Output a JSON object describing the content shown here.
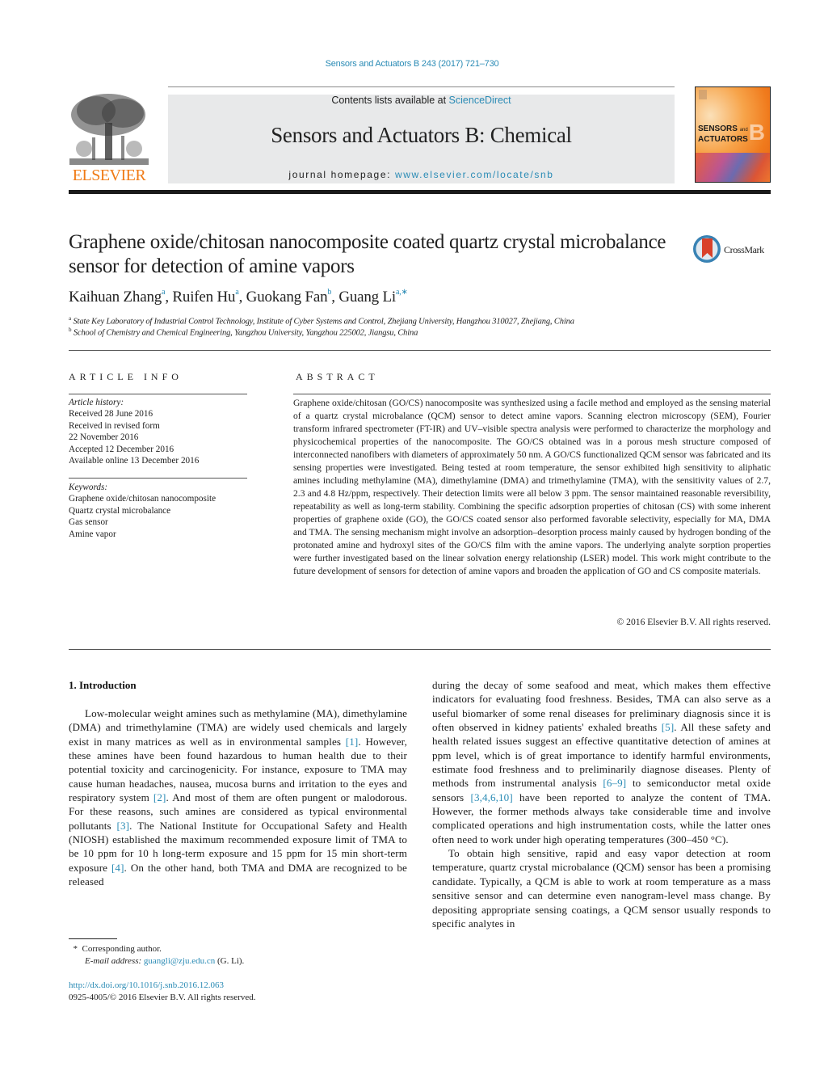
{
  "header": {
    "citation": "Sensors and Actuators B 243 (2017) 721–730",
    "contents_prefix": "Contents lists available at ",
    "contents_link": "ScienceDirect",
    "journal_title": "Sensors and Actuators B: Chemical",
    "homepage_prefix": "journal homepage: ",
    "homepage_link": "www.elsevier.com/locate/snb",
    "publisher_logo": "ELSEVIER",
    "cover": {
      "line1": "SENSORS",
      "and": "and",
      "line2": "ACTUATORS",
      "letter": "B"
    },
    "accent_color": "#2a8bb5",
    "publisher_color": "#f07b16"
  },
  "article": {
    "title": "Graphene oxide/chitosan nanocomposite coated quartz crystal microbalance sensor for detection of amine vapors",
    "crossmark": "CrossMark",
    "authors": [
      {
        "name": "Kaihuan Zhang",
        "sup": "a",
        "sep": ", "
      },
      {
        "name": "Ruifen Hu",
        "sup": "a",
        "sep": ", "
      },
      {
        "name": "Guokang Fan",
        "sup": "b",
        "sep": ", "
      },
      {
        "name": "Guang Li",
        "sup": "a,∗",
        "sep": ""
      }
    ],
    "affiliations": [
      {
        "key": "a",
        "text": "State Key Laboratory of Industrial Control Technology, Institute of Cyber Systems and Control, Zhejiang University, Hangzhou 310027, Zhejiang, China"
      },
      {
        "key": "b",
        "text": "School of Chemistry and Chemical Engineering, Yangzhou University, Yangzhou 225002, Jiangsu, China"
      }
    ]
  },
  "article_info": {
    "heading": "ARTICLE INFO",
    "history_label": "Article history:",
    "history": [
      "Received 28 June 2016",
      "Received in revised form",
      "22 November 2016",
      "Accepted 12 December 2016",
      "Available online 13 December 2016"
    ],
    "keywords_label": "Keywords:",
    "keywords": [
      "Graphene oxide/chitosan nanocomposite",
      "Quartz crystal microbalance",
      "Gas sensor",
      "Amine vapor"
    ]
  },
  "abstract": {
    "heading": "ABSTRACT",
    "text": "Graphene oxide/chitosan (GO/CS) nanocomposite was synthesized using a facile method and employed as the sensing material of a quartz crystal microbalance (QCM) sensor to detect amine vapors. Scanning elec­tron microscopy (SEM), Fourier transform infrared spectrometer (FT-IR) and UV–visible spectra analysis were performed to characterize the morphology and physicochemical properties of the nanocompos­ite. The GO/CS obtained was in a porous mesh structure composed of interconnected nanofibers with diameters of approximately 50 nm. A GO/CS functionalized QCM sensor was fabricated and its sensing properties were investigated. Being tested at room temperature, the sensor exhibited high sensitivity to aliphatic amines including methylamine (MA), dimethylamine (DMA) and trimethylamine (TMA), with the sensitivity values of 2.7, 2.3 and 4.8 Hz/ppm, respectively. Their detection limits were all below 3 ppm. The sensor maintained reasonable reversibility, repeatability as well as long-term stability. Combining the specific adsorption properties of chitosan (CS) with some inherent properties of graphene oxide (GO), the GO/CS coated sensor also performed favorable selectivity, especially for MA, DMA and TMA. The sens­ing mechanism might involve an adsorption–desorption process mainly caused by hydrogen bonding of the protonated amine and hydroxyl sites of the GO/CS film with the amine vapors. The underlying analyte sorption properties were further investigated based on the linear solvation energy relationship (LSER) model. This work might contribute to the future development of sensors for detection of amine vapors and broaden the application of GO and CS composite materials.",
    "copyright": "© 2016 Elsevier B.V. All rights reserved."
  },
  "introduction": {
    "heading": "1.  Introduction",
    "left_paragraph": [
      {
        "t": "Low-molecular weight amines such as methylamine (MA), dimethylamine (DMA) and trimethylamine (TMA) are widely used chemicals and largely exist in many matrices as well as in envi­ronmental samples "
      },
      {
        "ref": "[1]"
      },
      {
        "t": ". However, these amines have been found hazardous to human health due to their potential toxicity and carcinogenicity. For instance, exposure to TMA may cause human headaches, nausea, mucosa burns and irritation to the eyes and respiratory system "
      },
      {
        "ref": "[2]"
      },
      {
        "t": ". And most of them are often pungent or malodorous. For these reasons, such amines are considered as typical environmental pollutants "
      },
      {
        "ref": "[3]"
      },
      {
        "t": ". The National Institute for Occupational Safety and Health (NIOSH) established the maximum recommended exposure limit of TMA to be 10 ppm for 10 h long-term exposure and 15 ppm for 15 min short-term exposure "
      },
      {
        "ref": "[4]"
      },
      {
        "t": ". On the other hand, both TMA and DMA are recognized to be released"
      }
    ],
    "right_paragraph_1": [
      {
        "t": "during the decay of some seafood and meat, which makes them effective indicators for evaluating food freshness. Besides, TMA can also serve as a useful biomarker of some renal diseases for prelimi­nary diagnosis since it is often observed in kidney patients' exhaled breaths "
      },
      {
        "ref": "[5]"
      },
      {
        "t": ". All these safety and health related issues suggest an effective quantitative detection of amines at ppm level, which is of great importance to identify harmful environments, estimate food freshness and to preliminarily diagnose diseases. Plenty of methods from instrumental analysis "
      },
      {
        "ref": "[6–9]"
      },
      {
        "t": " to semiconductor metal oxide sensors "
      },
      {
        "ref": "[3,4,6,10]"
      },
      {
        "t": " have been reported to analyze the content of TMA. However, the former methods always take considerable time and involve complicated operations and high instrumentation costs, while the latter ones often need to work under high operating temperatures (300–450 °C)."
      }
    ],
    "right_paragraph_2": [
      {
        "t": "To obtain high sensitive, rapid and easy vapor detection at room temperature, quartz crystal microbalance (QCM) sensor has been a promising candidate. Typically, a QCM is able to work at room temperature as a mass sensitive sensor and can determine even nanogram-level mass change. By depositing appropriate sensing coatings, a QCM sensor usually responds to specific analytes in"
      }
    ]
  },
  "footnote": {
    "mark": "*",
    "corresponding": "Corresponding author.",
    "email_label": "E-mail address: ",
    "email": "guangli@zju.edu.cn",
    "email_suffix": " (G. Li).",
    "doi": "http://dx.doi.org/10.1016/j.snb.2016.12.063",
    "issn_line": "0925-4005/© 2016 Elsevier B.V. All rights reserved."
  }
}
